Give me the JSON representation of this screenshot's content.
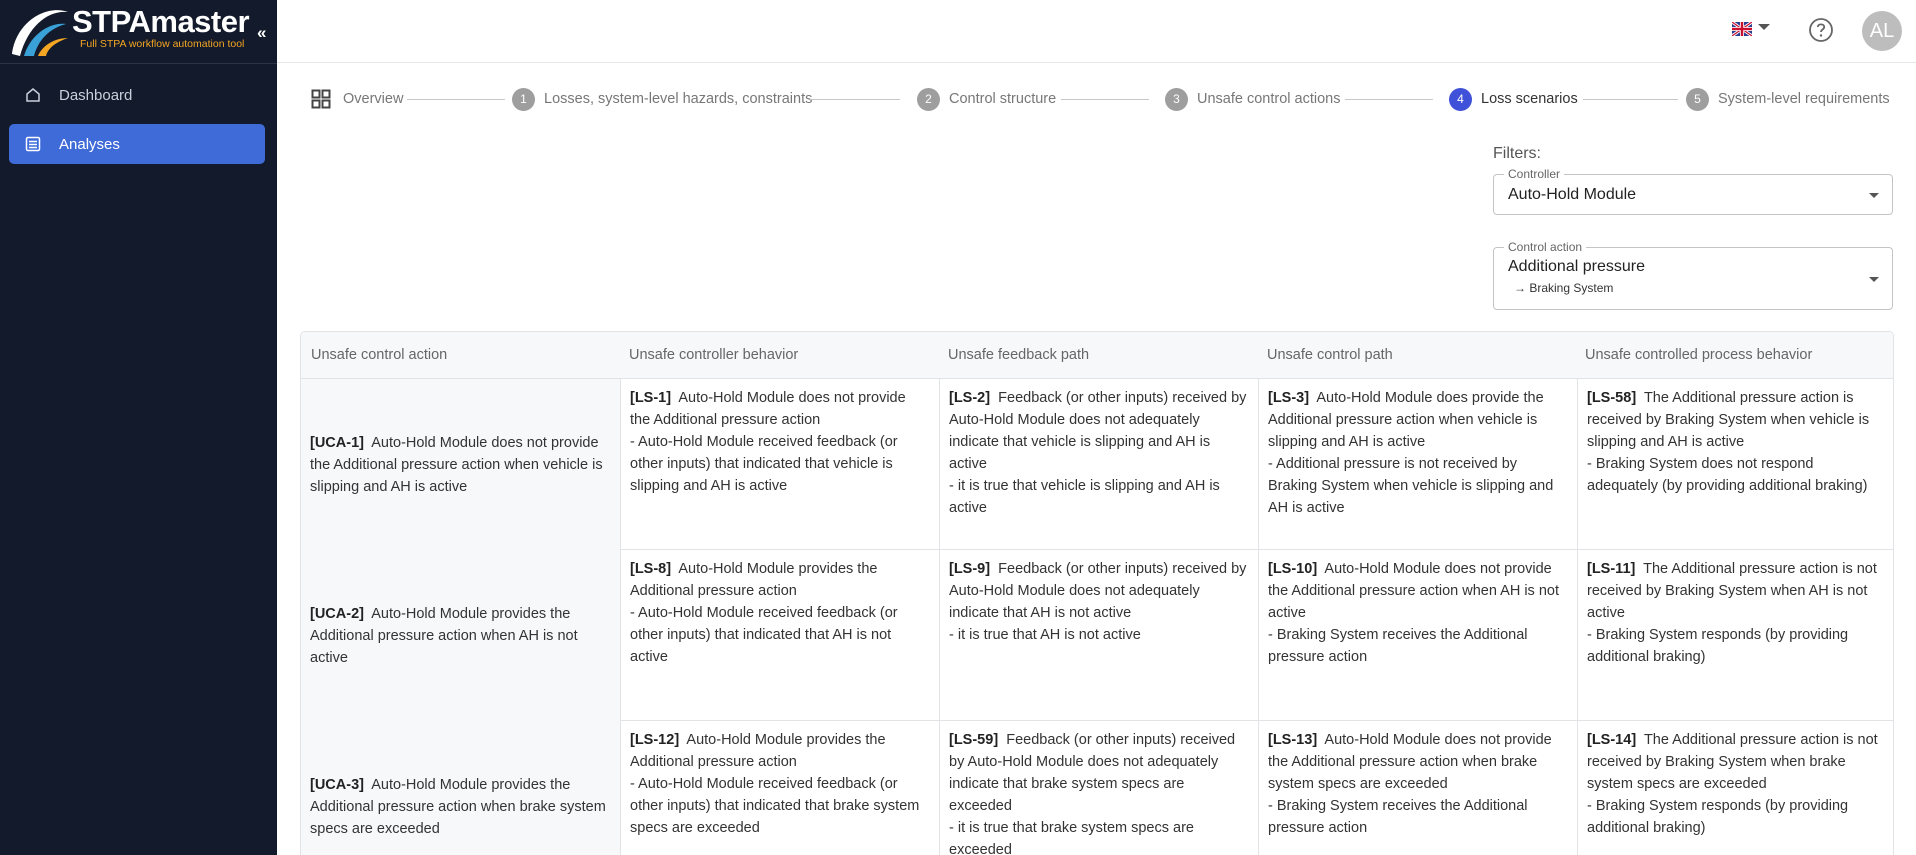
{
  "app": {
    "logo_title": "STPAmaster",
    "logo_subtitle": "Full STPA workflow automation tool",
    "collapse_glyph": "«"
  },
  "sidebar": {
    "items": [
      {
        "label": "Dashboard",
        "icon": "home-icon",
        "active": false
      },
      {
        "label": "Analyses",
        "icon": "list-icon",
        "active": true
      }
    ]
  },
  "header": {
    "language_flag": "uk-flag-icon",
    "help_icon": "help-circle-icon",
    "avatar_initials": "AL"
  },
  "stepper": {
    "overview_label": "Overview",
    "steps": [
      {
        "num": "1",
        "label": "Losses, system-level hazards, constraints",
        "active": false
      },
      {
        "num": "2",
        "label": "Control structure",
        "active": false
      },
      {
        "num": "3",
        "label": "Unsafe control actions",
        "active": false
      },
      {
        "num": "4",
        "label": "Loss scenarios",
        "active": true
      },
      {
        "num": "5",
        "label": "System-level requirements",
        "active": false
      }
    ]
  },
  "filters": {
    "label": "Filters:",
    "controller": {
      "label": "Controller",
      "value": "Auto-Hold Module"
    },
    "control_action": {
      "label": "Control action",
      "value": "Additional pressure",
      "target": "Braking System",
      "arrow": "→"
    }
  },
  "table": {
    "columns": [
      "Unsafe control action",
      "Unsafe controller behavior",
      "Unsafe feedback path",
      "Unsafe control path",
      "Unsafe controlled process behavior"
    ],
    "rows": [
      {
        "uca": {
          "id": "[UCA-1]",
          "text": "Auto-Hold Module does not provide the Additional pressure action when vehicle is slipping and AH is active"
        },
        "cells": [
          {
            "id": "[LS-1]",
            "text": "Auto-Hold Module does not provide the Additional pressure action",
            "detail": "- Auto-Hold Module received feedback (or other inputs) that indicated that vehicle is slipping and AH is active"
          },
          {
            "id": "[LS-2]",
            "text": "Feedback (or other inputs) received by Auto-Hold Module does not adequately indicate that vehicle is slipping and AH is active",
            "detail": "- it is true that vehicle is slipping and AH is active"
          },
          {
            "id": "[LS-3]",
            "text": "Auto-Hold Module does provide the Additional pressure action when vehicle is slipping and AH is active",
            "detail": "- Additional pressure is not received by Braking System when vehicle is slipping and AH is active"
          },
          {
            "id": "[LS-58]",
            "text": "The Additional pressure action is received by Braking System when vehicle is slipping and AH is active",
            "detail": "- Braking System does not respond adequately (by providing additional braking)"
          }
        ]
      },
      {
        "uca": {
          "id": "[UCA-2]",
          "text": "Auto-Hold Module provides the Additional pressure action when AH is not active"
        },
        "cells": [
          {
            "id": "[LS-8]",
            "text": "Auto-Hold Module provides the Additional pressure action",
            "detail": "- Auto-Hold Module received feedback (or other inputs) that indicated that AH is not active"
          },
          {
            "id": "[LS-9]",
            "text": "Feedback (or other inputs) received by Auto-Hold Module does not adequately indicate that AH is not active",
            "detail": "- it is true that AH is not active"
          },
          {
            "id": "[LS-10]",
            "text": "Auto-Hold Module does not provide the Additional pressure action when AH is not active",
            "detail": "- Braking System receives the Additional pressure action"
          },
          {
            "id": "[LS-11]",
            "text": "The Additional pressure action is not received by Braking System when AH is not active",
            "detail": "- Braking System responds (by providing additional braking)"
          }
        ]
      },
      {
        "uca": {
          "id": "[UCA-3]",
          "text": "Auto-Hold Module provides the Additional pressure action when brake system specs are exceeded"
        },
        "cells": [
          {
            "id": "[LS-12]",
            "text": "Auto-Hold Module provides the Additional pressure action",
            "detail": "- Auto-Hold Module received feedback (or other inputs) that indicated that brake system specs are exceeded"
          },
          {
            "id": "[LS-59]",
            "text": "Feedback (or other inputs) received by Auto-Hold Module does not adequately indicate that brake system specs are exceeded",
            "detail": "- it is true that brake system specs are exceeded"
          },
          {
            "id": "[LS-13]",
            "text": "Auto-Hold Module does not provide the Additional pressure action when brake system specs are exceeded",
            "detail": "- Braking System receives the Additional pressure action"
          },
          {
            "id": "[LS-14]",
            "text": "The Additional pressure action is not received by Braking System when brake system specs are exceeded",
            "detail": "- Braking System responds (by providing additional braking)"
          }
        ]
      }
    ]
  },
  "colors": {
    "sidebar_bg": "#121a2b",
    "active_nav": "#3f6bd8",
    "active_step": "#3f51d8",
    "logo_accent": "#f5a623"
  }
}
